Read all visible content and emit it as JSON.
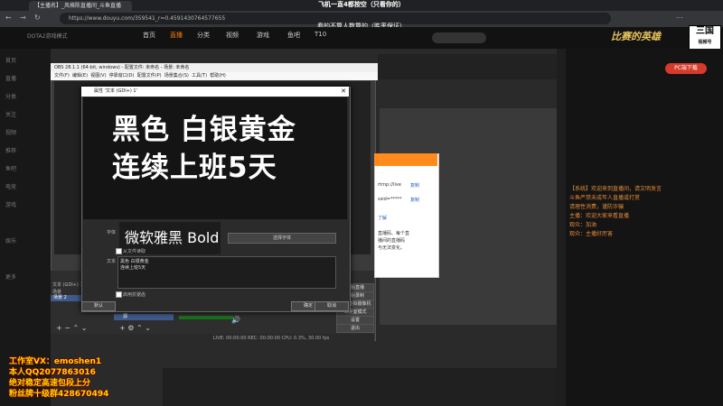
{
  "browser": {
    "tab_title": "【主播名】_风格陈直播间_斗鱼直播",
    "url": "https://www.douyu.com/359541_r=0.4591430764577655",
    "top_banner": "飞机一直4都按空（只看你的）",
    "sub_banner": "看的不算人数算的（胜率保证）"
  },
  "site": {
    "logo": "DOTA2游戏模式",
    "nav": [
      "首页",
      "直播",
      "分类",
      "视频",
      "游戏",
      "鱼吧",
      "T10"
    ],
    "brand_right": "比赛的英雄",
    "badge_text": "三国",
    "badge_sub": "视频号",
    "badge_num": "35954"
  },
  "leftbar": {
    "items": [
      "首页",
      "直播",
      "分类",
      "关注",
      "视频",
      "推荐",
      "鱼吧",
      "电竞",
      "游戏",
      "娱乐",
      "更多"
    ]
  },
  "obs": {
    "title": "OBS 28.1.1 (64-bit, windows) - 配置文件: 未命名 - 场景: 未命名",
    "menu": [
      "文件(F)",
      "编辑(E)",
      "视图(V)",
      "停靠窗口(D)",
      "配置文件(P)",
      "场景集合(S)",
      "工具(T)",
      "帮助(H)"
    ],
    "scene_label": "场景",
    "scene_item": "场景 2",
    "source_label": "文本 (GDI+) 1",
    "source_item": "源",
    "controls": [
      "开始直播",
      "开始录制",
      "启动虚拟摄像机",
      "工作室模式",
      "设置",
      "退出"
    ],
    "status": "LIVE: 00:00:00   REC: 00:00:00   CPU: 0.3%, 30.00 fps"
  },
  "dialog": {
    "title": "属性 '文本 (GDI+) 1'",
    "close": "✕",
    "preview_line1": "黑色 白银黄金",
    "preview_line2": "连续上班5天",
    "font_label": "字体",
    "font_value": "微软雅黑 Bold",
    "select_font": "选择字体",
    "read_from_file": "从文件读取",
    "text_label": "文本",
    "text_value": "黑色 白银黄金\n连续上班5天",
    "vertical": "启用抗锯齿",
    "default_btn": "默认",
    "ok_btn": "确定",
    "cancel_btn": "取消"
  },
  "orange_dialog": {
    "lines": [
      "rtmp://live",
      "复制",
      "ssid=*****",
      "复制",
      "了解",
      "直播码、每个直",
      "播间的直播码",
      "与无法变化。"
    ]
  },
  "right_panel": {
    "pc_button": "PC端下载",
    "chat": [
      "【系统】欢迎来到直播间，请文明发言",
      "斗鱼严禁未成年人直播或打赏",
      "请理性消费，谨防诈骗",
      "主播：欢迎大家来看直播",
      "观众：加油",
      "观众：主播好厉害"
    ]
  },
  "watermark": {
    "line1": "工作室VX：emoshen1",
    "line2": "本人QQ2077863016",
    "line3": "绝对稳定高速包段上分",
    "line4": "粉丝牌十级群428670494"
  }
}
